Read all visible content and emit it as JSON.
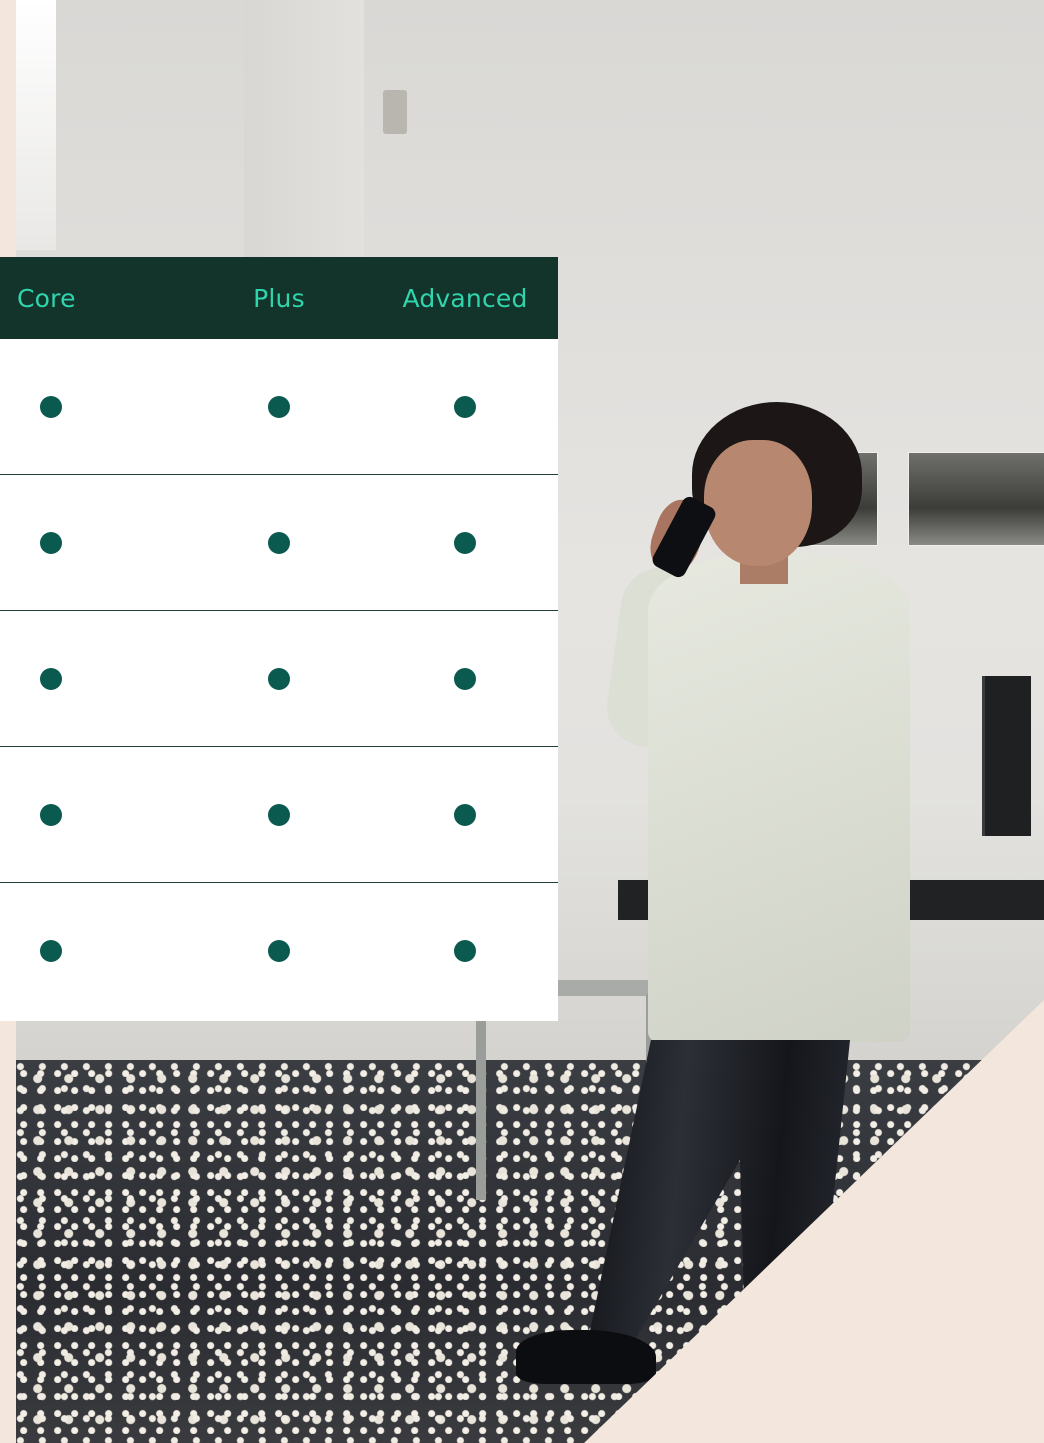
{
  "table": {
    "columns": [
      {
        "label": "Core"
      },
      {
        "label": "Plus"
      },
      {
        "label": "Advanced"
      }
    ],
    "rows": [
      {
        "core": true,
        "plus": true,
        "advanced": true
      },
      {
        "core": true,
        "plus": true,
        "advanced": true
      },
      {
        "core": true,
        "plus": true,
        "advanced": true
      },
      {
        "core": true,
        "plus": true,
        "advanced": true
      },
      {
        "core": true,
        "plus": true,
        "advanced": true
      }
    ],
    "indicator_icon": "filled-circle-icon"
  },
  "colors": {
    "header_background": "#12342b",
    "header_text": "#30d5ad",
    "indicator": "#0b5a50",
    "page_background": "#f3e6dc",
    "row_divider": "#25423a"
  }
}
